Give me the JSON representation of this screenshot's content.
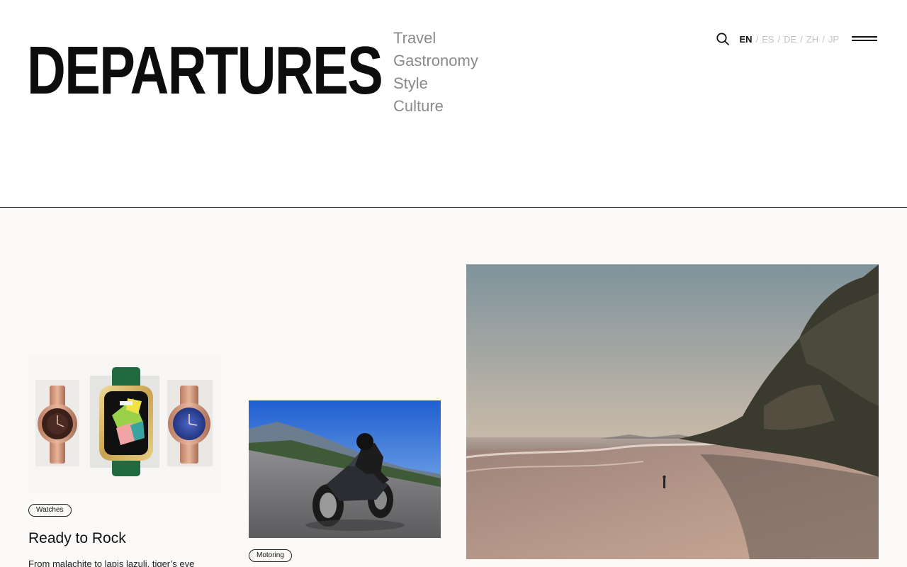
{
  "brand": {
    "logo_text": "DEPARTURES"
  },
  "nav": {
    "items": [
      "Travel",
      "Gastronomy",
      "Style",
      "Culture"
    ]
  },
  "languages": {
    "items": [
      "EN",
      "ES",
      "DE",
      "ZH",
      "JP"
    ],
    "active": "EN",
    "separator": "/"
  },
  "icons": {
    "search": "search-icon",
    "menu": "hamburger-menu-icon"
  },
  "cards": [
    {
      "tag": "Watches",
      "title": "Ready to Rock",
      "excerpt": "From malachite to lapis lazuli, tiger’s eye",
      "image": "three-luxury-watches"
    },
    {
      "tag": "Motoring",
      "image": "motorcyclist-leaning-on-road"
    },
    {
      "image": "beach-cliff-sunset-lone-figure"
    }
  ],
  "colors": {
    "text": "#111111",
    "nav_gray": "#8a8a8a",
    "lang_inactive": "#c3c3c3",
    "content_bg": "#fbfaf8"
  }
}
